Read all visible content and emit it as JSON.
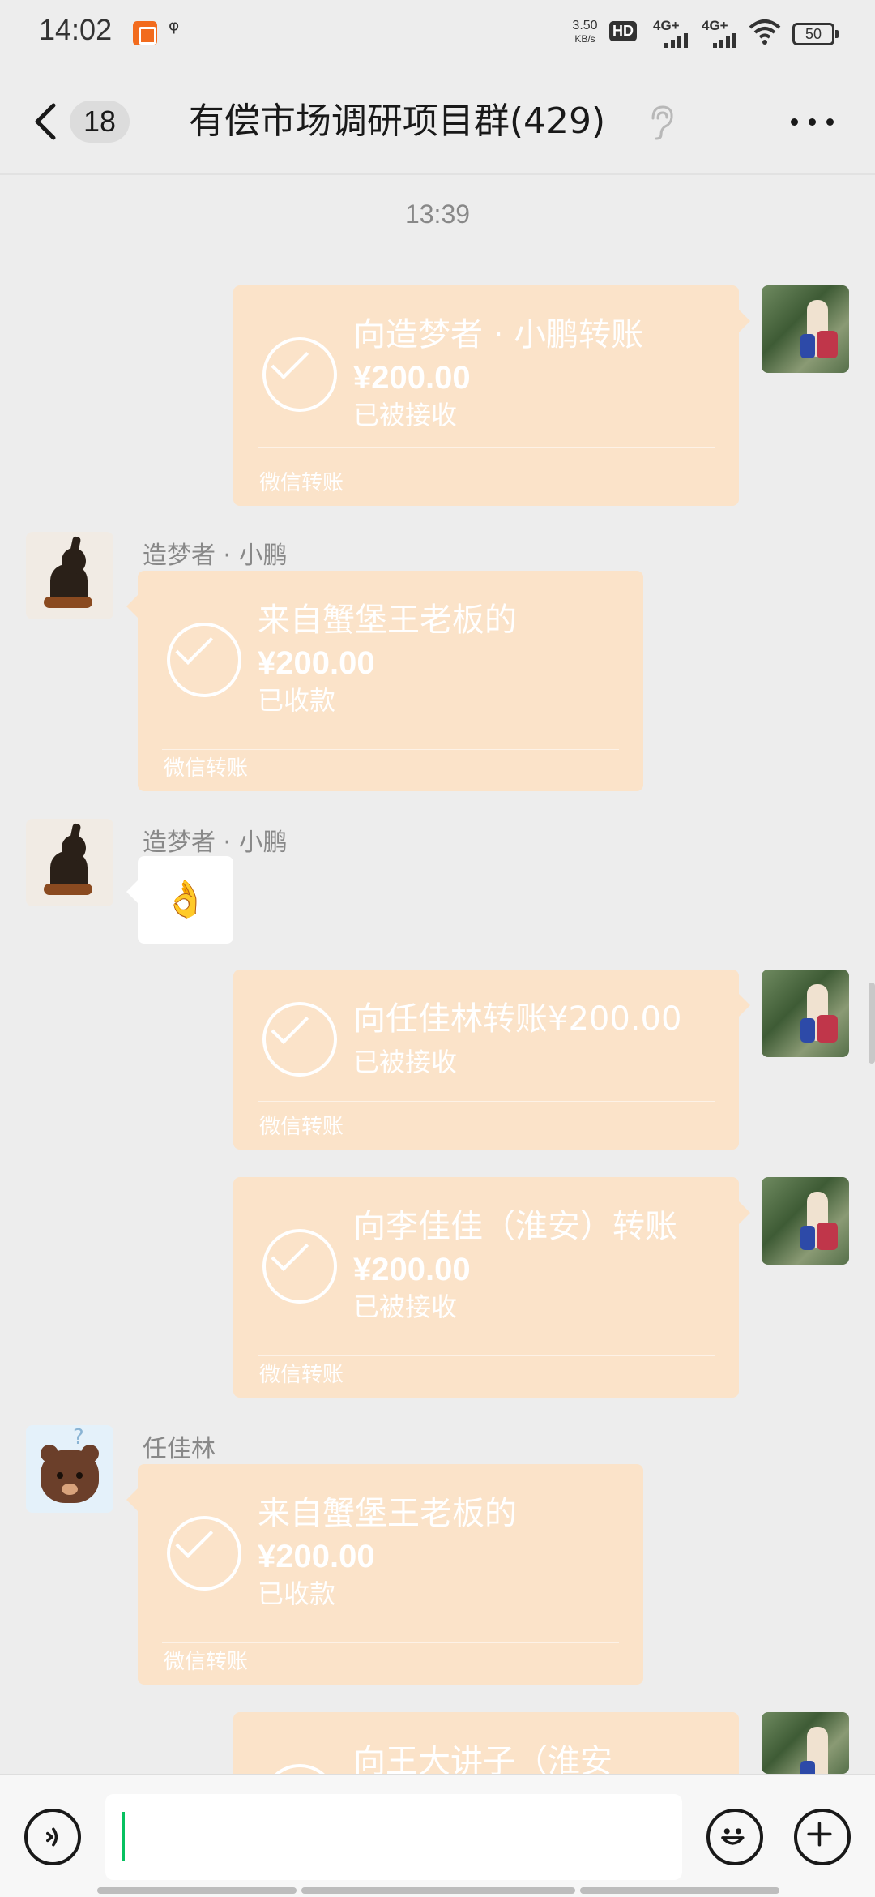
{
  "status_bar": {
    "time": "14:02",
    "net_speed_value": "3.50",
    "net_speed_unit": "KB/s",
    "hd_badge": "HD",
    "signal_1": "4G+",
    "signal_2": "4G+",
    "battery": "50"
  },
  "nav": {
    "back_count": "18",
    "title": "有偿市场调研项目群(429)"
  },
  "timestamp": "13:39",
  "messages": [
    {
      "sender": "me",
      "title": "向造梦者 · 小鹏转账",
      "amount": "¥200.00",
      "status": "已被接收",
      "footer": "微信转账"
    },
    {
      "sender_name": "造梦者 · 小鹏",
      "title": "来自蟹堡王老板的",
      "amount": "¥200.00",
      "status": "已收款",
      "footer": "微信转账"
    },
    {
      "sender_name": "造梦者 · 小鹏",
      "emoji": "👌",
      "emoji_color": "#e7b02f"
    },
    {
      "sender": "me",
      "title": "向任佳林转账¥200.00",
      "status": "已被接收",
      "footer": "微信转账"
    },
    {
      "sender": "me",
      "title": "向李佳佳（淮安）转账",
      "amount": "¥200.00",
      "status": "已被接收",
      "footer": "微信转账"
    },
    {
      "sender_name": "任佳林",
      "title": "来自蟹堡王老板的",
      "amount": "¥200.00",
      "status": "已收款",
      "footer": "微信转账"
    },
    {
      "sender": "me",
      "title": "向王大讲子（淮安"
    }
  ],
  "input": {
    "placeholder": ""
  },
  "colors": {
    "card": "#fbe3c9",
    "cursor": "#07c160",
    "background": "#ededed"
  },
  "icons": [
    "back-chevron-icon",
    "ear-icon",
    "more-icon",
    "voice-icon",
    "emoji-icon",
    "plus-icon",
    "check-circle-icon",
    "wifi-icon",
    "battery-icon"
  ]
}
